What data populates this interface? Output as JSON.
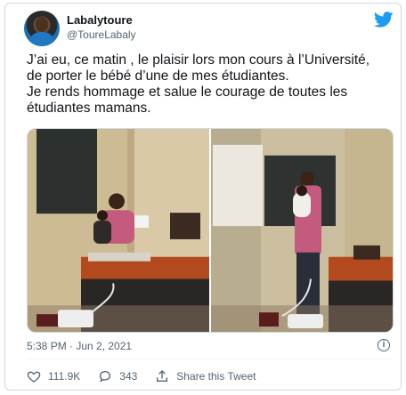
{
  "author": {
    "name": "Labalytoure",
    "handle": "@ToureLabaly"
  },
  "icons": {
    "brand": "twitter-bird-icon",
    "info": "info-icon",
    "like": "heart-icon",
    "reply": "reply-bubble-icon",
    "share": "share-icon"
  },
  "tweet": {
    "line1": "J’ai eu, ce matin , le plaisir lors mon cours  à l’Université,",
    "line2": "de porter le bébé d’une de mes étudiantes.",
    "line3": "Je rends hommage et salue le courage de toutes les",
    "line4": "étudiantes mamans."
  },
  "meta": {
    "timestamp": "5:38 PM · Jun 2, 2021"
  },
  "actions": {
    "likes": "111.9K",
    "replies": "343",
    "share_label": "Share this Tweet"
  },
  "colors": {
    "brand_blue": "#1d9bf0",
    "text_secondary": "#536471",
    "border": "#cfd9de"
  }
}
